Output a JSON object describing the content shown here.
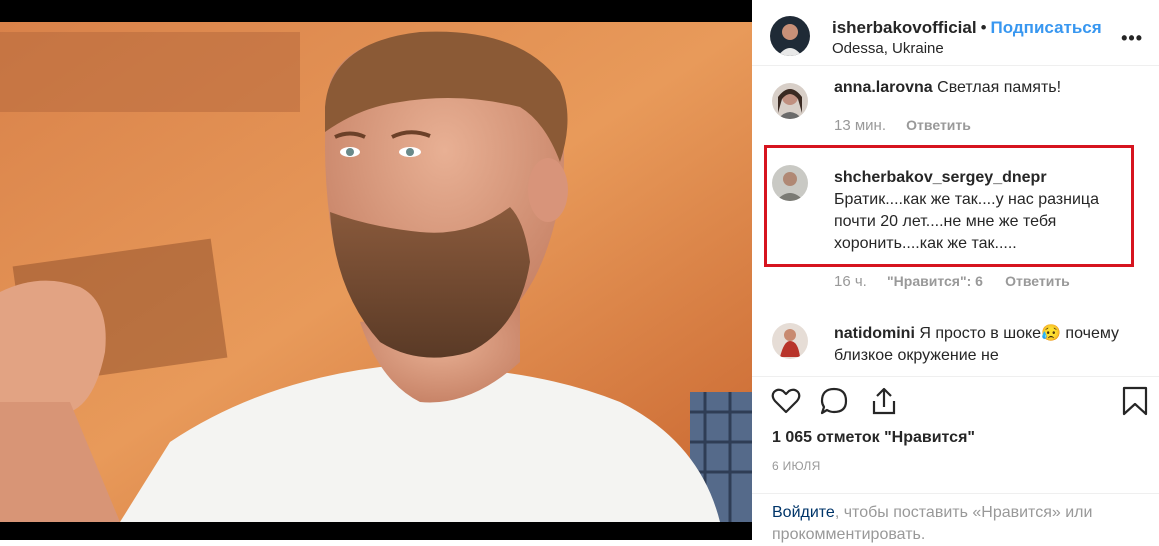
{
  "post": {
    "username": "isherbakovofficial",
    "separator": "•",
    "follow_label": "Подписаться",
    "location": "Odessa, Ukraine",
    "more_icon": "more-horizontal-icon",
    "more_glyph": "•••"
  },
  "comments": [
    {
      "username": "anna.larovna",
      "text": "Светлая память!",
      "time": "13 мин.",
      "reply_label": "Ответить"
    },
    {
      "username": "shcherbakov_sergey_dnepr",
      "text": "Братик....как же так....у нас разница почти 20 лет....не мне же тебя хоронить....как же так.....",
      "time": "16 ч.",
      "likes_label": "\"Нравится\": 6",
      "reply_label": "Ответить"
    },
    {
      "username": "natidomini",
      "text": "Я просто в шоке😥 почему близкое окружение не",
      "emoji_icon": "sad-face-icon"
    }
  ],
  "actions": {
    "like_icon": "heart-icon",
    "comment_icon": "comment-icon",
    "share_icon": "share-icon",
    "save_icon": "bookmark-icon",
    "likes_count": "1 065 отметок \"Нравится\"",
    "date": "6 ИЮЛЯ",
    "login_link": "Войдите",
    "login_rest": ", чтобы поставить «Нравится» или прокомментировать."
  },
  "colors": {
    "link_blue": "#3897f0",
    "highlight_red": "#d6141f",
    "muted_gray": "#999999",
    "login_link": "#003569"
  }
}
